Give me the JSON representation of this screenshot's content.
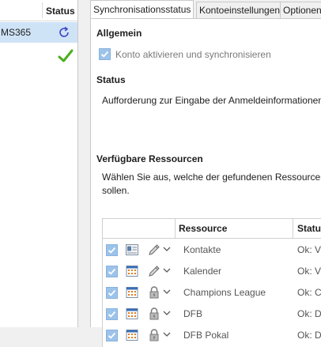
{
  "accounts_panel": {
    "column_status": "Status",
    "account_name": "MS365"
  },
  "tabs": [
    {
      "label": "Synchronisationsstatus",
      "active": true
    },
    {
      "label": "Kontoeinstellungen",
      "active": false
    },
    {
      "label": "Optionen",
      "active": false
    }
  ],
  "general": {
    "heading": "Allgemein",
    "checkbox_label": "Konto aktivieren und synchronisieren"
  },
  "status": {
    "heading": "Status",
    "text": "Aufforderung zur Eingabe der Anmeldeinformationen"
  },
  "resources": {
    "heading": "Verfügbare Ressourcen",
    "description_line1": "Wählen Sie aus, welche der gefundenen Ressourcen r",
    "description_line2": "sollen.",
    "column_resource": "Ressource",
    "column_status": "Status",
    "rows": [
      {
        "name": "Kontakte",
        "status": "Ok: V",
        "type": "contacts",
        "access": "edit"
      },
      {
        "name": "Kalender",
        "status": "Ok: V",
        "type": "calendar",
        "access": "edit"
      },
      {
        "name": "Champions League",
        "status": "Ok: C",
        "type": "calendar",
        "access": "locked"
      },
      {
        "name": "DFB",
        "status": "Ok: D",
        "type": "calendar",
        "access": "locked"
      },
      {
        "name": "DFB Pokal",
        "status": "Ok: D",
        "type": "calendar",
        "access": "locked"
      }
    ]
  },
  "colors": {
    "selection": "#cfe3f7",
    "checkbox": "#9cc3ea",
    "success": "#4caf1e",
    "sync": "#3c46c8"
  }
}
